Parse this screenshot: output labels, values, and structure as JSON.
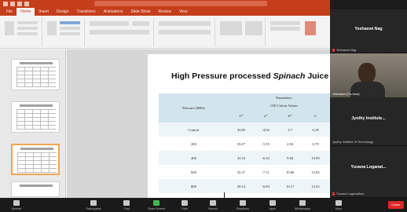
{
  "ribbon": {
    "tabs": [
      "File",
      "Home",
      "Insert",
      "Design",
      "Transitions",
      "Animations",
      "Slide Show",
      "Review",
      "View"
    ]
  },
  "slide": {
    "title_plain": "High Pressure processed ",
    "title_italic": "Spinach",
    "title_end": " Juice",
    "table": {
      "pressure_header": "Pressure (MPa)",
      "parameters_header": "Parameters",
      "cie_header": "CIE Colour Values",
      "columns": [
        "L*",
        "a*",
        "b*",
        "C",
        ""
      ],
      "rows": [
        {
          "pressure": "Control",
          "values": [
            "33.85",
            "-4.02",
            "4.7",
            "6.18",
            "13"
          ]
        },
        {
          "pressure": "200",
          "values": [
            "35.6*",
            "-5.55",
            "4.92",
            "6.79",
            "13"
          ]
        },
        {
          "pressure": "400",
          "values": [
            "33.53",
            "-6.32",
            "9.84",
            "10.99",
            "12"
          ]
        },
        {
          "pressure": "600",
          "values": [
            "32.4*",
            "-7.11",
            "10.66",
            "12.82",
            "12"
          ]
        },
        {
          "pressure": "800",
          "values": [
            "20.14",
            "-6.83",
            "10.17",
            "12.25",
            "12"
          ]
        }
      ]
    }
  },
  "zoom": {
    "participants": [
      {
        "name": "Yeshaswi Nag",
        "label": "Yeshaswi Nag"
      },
      {
        "label": "Yeshaswi (Co-host)"
      },
      {
        "name": "Jyothy Institute...",
        "label": "Jyothy Institute of Technology"
      },
      {
        "name": "Yuvana Loganat...",
        "label": "Yuvana Loganathan"
      }
    ]
  },
  "toolbar": {
    "buttons": [
      "Unmute",
      "Participants",
      "Chat",
      "Share Screen",
      "Polls",
      "Record",
      "Reactions",
      "Apps",
      "Whiteboards",
      "More"
    ],
    "end_label": "Leave"
  },
  "colors": {
    "powerpoint_accent": "#c43e1c",
    "table_header": "#d3e5ec",
    "zoom_end": "#e02828"
  }
}
